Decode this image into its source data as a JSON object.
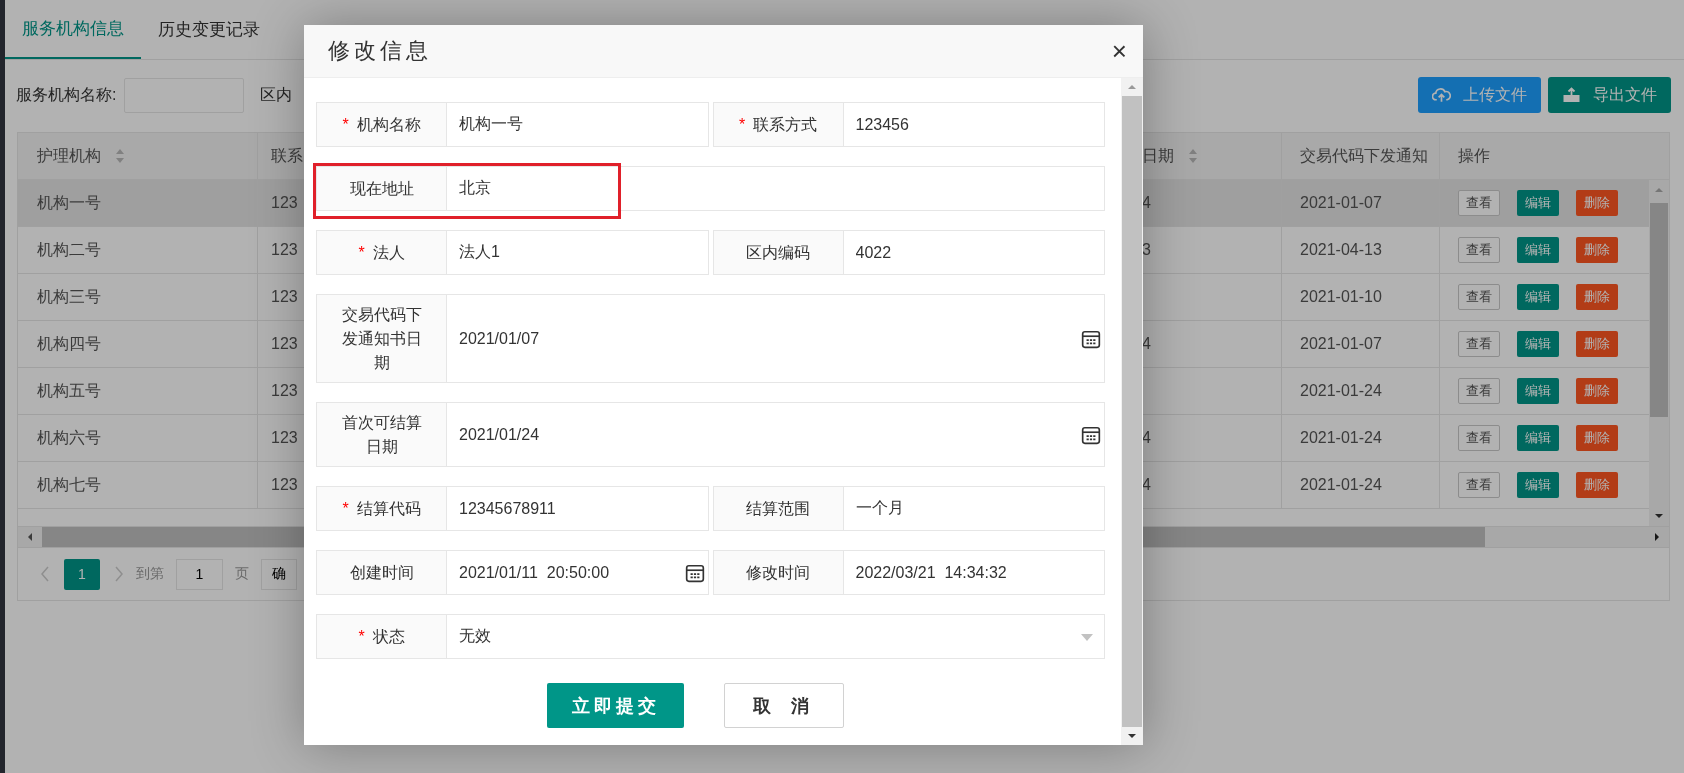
{
  "tabs": [
    {
      "label": "服务机构信息",
      "selected": true
    },
    {
      "label": "历史变更记录",
      "selected": false
    }
  ],
  "filter": {
    "label": "服务机构名称:",
    "label_2": "区内"
  },
  "toolbar_buttons": [
    {
      "label": "上传文件",
      "kind": "upload"
    },
    {
      "label": "导出文件",
      "kind": "export"
    }
  ],
  "table": {
    "columns": [
      {
        "label": "护理机构",
        "sortable": true
      },
      {
        "label": "联系"
      },
      {
        "label": "日期",
        "sortable": true
      },
      {
        "label": "交易代码下发通知"
      },
      {
        "label": "操作"
      }
    ],
    "rows": [
      {
        "cells": [
          "机构一号",
          "123",
          "4",
          "2021-01-07"
        ],
        "actions": [
          "查看",
          "编辑",
          "删除"
        ],
        "selected": true
      },
      {
        "cells": [
          "机构二号",
          "123",
          "3",
          "2021-04-13"
        ],
        "actions": [
          "查看",
          "编辑",
          "删除"
        ],
        "selected": false
      },
      {
        "cells": [
          "机构三号",
          "123",
          "",
          "2021-01-10"
        ],
        "actions": [
          "查看",
          "编辑",
          "删除"
        ],
        "selected": false
      },
      {
        "cells": [
          "机构四号",
          "123",
          "4",
          "2021-01-07"
        ],
        "actions": [
          "查看",
          "编辑",
          "删除"
        ],
        "selected": false
      },
      {
        "cells": [
          "机构五号",
          "123",
          "",
          "2021-01-24"
        ],
        "actions": [
          "查看",
          "编辑",
          "删除"
        ],
        "selected": false
      },
      {
        "cells": [
          "机构六号",
          "123",
          "4",
          "2021-01-24"
        ],
        "actions": [
          "查看",
          "编辑",
          "删除"
        ],
        "selected": false
      },
      {
        "cells": [
          "机构七号",
          "123",
          "4",
          "2021-01-24"
        ],
        "actions": [
          "查看",
          "编辑",
          "删除"
        ],
        "selected": false
      }
    ]
  },
  "pagination": {
    "pages": [
      {
        "label": "1",
        "selected": true
      }
    ],
    "goto_label": "到第",
    "page_input": "1",
    "page_label": "页",
    "confirm": "确"
  },
  "dialog": {
    "title": "修改信息",
    "close": "×",
    "form_rows": [
      {
        "items": [
          {
            "label": "机构名称",
            "required_mark": "*",
            "value": "机构一号",
            "kind": "text",
            "highlighted": false
          },
          {
            "label": "联系方式",
            "required_mark": "*",
            "value": "123456",
            "kind": "text",
            "highlighted": false
          }
        ]
      },
      {
        "items": [
          {
            "label": "现在地址",
            "value": "北京",
            "kind": "text",
            "highlighted": true
          }
        ]
      },
      {
        "items": [
          {
            "label": "法人",
            "required_mark": "*",
            "value": "法人1",
            "kind": "text",
            "highlighted": false
          },
          {
            "label": "区内编码",
            "value": "4022",
            "kind": "text",
            "highlighted": false
          }
        ]
      },
      {
        "items": [
          {
            "label": "交易代码下发通知书日期",
            "value": "2021/01/07",
            "kind": "date",
            "highlighted": false
          }
        ]
      },
      {
        "items": [
          {
            "label": "首次可结算日期",
            "value": "2021/01/24",
            "kind": "date",
            "highlighted": false
          }
        ]
      },
      {
        "items": [
          {
            "label": "结算代码",
            "required_mark": "*",
            "value": "12345678911",
            "kind": "text",
            "highlighted": false
          },
          {
            "label": "结算范围",
            "value": "一个月",
            "kind": "text",
            "highlighted": false
          }
        ]
      },
      {
        "items": [
          {
            "label": "创建时间",
            "value": "2021/01/11  20:50:00",
            "kind": "date",
            "highlighted": false
          },
          {
            "label": "修改时间",
            "value": "2022/03/21  14:34:32",
            "kind": "text",
            "highlighted": false
          }
        ]
      },
      {
        "items": [
          {
            "label": "状态",
            "required_mark": "*",
            "value": "无效",
            "kind": "select",
            "highlighted": false
          }
        ]
      }
    ],
    "buttons": [
      {
        "label": "立即提交",
        "kind": "primary"
      },
      {
        "label": "取消",
        "kind": "secondary"
      }
    ]
  }
}
